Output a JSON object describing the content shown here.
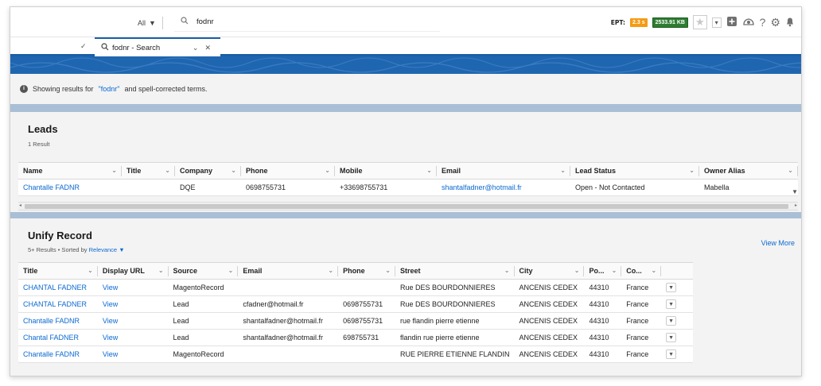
{
  "header": {
    "scope_label": "All",
    "search_value": "fodnr",
    "ept_label": "EPT:",
    "ept_time": "2.3 s",
    "ept_size": "2533.91 KB"
  },
  "tab": {
    "label": "fodnr - Search"
  },
  "info": {
    "prefix": "Showing results for",
    "term": "\"fodnr\"",
    "suffix": "and spell-corrected terms."
  },
  "leads": {
    "title": "Leads",
    "count": "1 Result",
    "columns": [
      "Name",
      "Title",
      "Company",
      "Phone",
      "Mobile",
      "Email",
      "Lead Status",
      "Owner Alias"
    ],
    "rows": [
      {
        "name": "Chantalle FADNR",
        "title": "",
        "company": "DQE",
        "phone": "0698755731",
        "mobile": "+33698755731",
        "email": "shantalfadner@hotmail.fr",
        "status": "Open - Not Contacted",
        "owner": "Mabella"
      }
    ]
  },
  "unify": {
    "title": "Unify Record",
    "subtitle_prefix": "5+ Results • Sorted by",
    "sort_by": "Relevance",
    "view_more": "View More",
    "columns": [
      "Title",
      "Display URL",
      "Source",
      "Email",
      "Phone",
      "Street",
      "City",
      "Po...",
      "Co..."
    ],
    "rows": [
      {
        "title": "CHANTAL FADNER",
        "url": "View",
        "source": "MagentoRecord",
        "email": "",
        "phone": "",
        "street": "Rue DES BOURDONNIERES",
        "city": "ANCENIS CEDEX",
        "postal": "44310",
        "country": "France"
      },
      {
        "title": "CHANTAL FADNER",
        "url": "View",
        "source": "Lead",
        "email": "cfadner@hotmail.fr",
        "phone": "0698755731",
        "street": "Rue DES BOURDONNIERES",
        "city": "ANCENIS CEDEX",
        "postal": "44310",
        "country": "France"
      },
      {
        "title": "Chantalle FADNR",
        "url": "View",
        "source": "Lead",
        "email": "shantalfadner@hotmail.fr",
        "phone": "0698755731",
        "street": "rue flandin pierre etienne",
        "city": "ANCENIS CEDEX",
        "postal": "44310",
        "country": "France"
      },
      {
        "title": "Chantal FADNER",
        "url": "View",
        "source": "Lead",
        "email": "shantalfadner@hotmail.fr",
        "phone": "698755731",
        "street": "flandin rue pierre etienne",
        "city": "ANCENIS CEDEX",
        "postal": "44310",
        "country": "France"
      },
      {
        "title": "Chantalle FADNR",
        "url": "View",
        "source": "MagentoRecord",
        "email": "",
        "phone": "",
        "street": "RUE PIERRE ETIENNE FLANDIN",
        "city": "ANCENIS CEDEX",
        "postal": "44310",
        "country": "France"
      }
    ]
  },
  "colors": {
    "brand_blue": "#1f66b0",
    "link_blue": "#0b69d1",
    "ept_orange": "#f49b14",
    "ept_green": "#2e7d32"
  }
}
